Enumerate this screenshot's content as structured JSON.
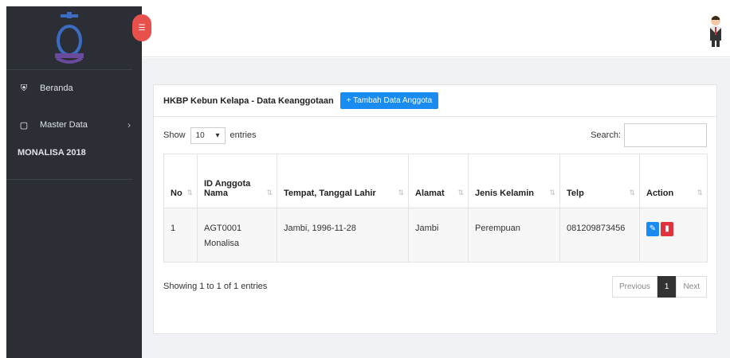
{
  "sidebar": {
    "items": [
      {
        "icon": "home-icon",
        "label": "Beranda",
        "has_chevron": false
      },
      {
        "icon": "clipboard-icon",
        "label": "Master Data",
        "has_chevron": true
      }
    ],
    "section_label": "MONALISA 2018"
  },
  "card": {
    "title": "HKBP Kebun Kelapa - Data Keanggotaan",
    "add_button": "+ Tambah Data Anggota"
  },
  "controls": {
    "show_label": "Show",
    "entries_value": "10",
    "entries_label": "entries",
    "search_label": "Search:"
  },
  "table": {
    "headers": [
      "No",
      "ID Anggota",
      "Nama",
      "Tempat, Tanggal Lahir",
      "Alamat",
      "Jenis Kelamin",
      "Telp",
      "Action"
    ],
    "rows": [
      {
        "no": "1",
        "id": "AGT0001",
        "nama": "Monalisa",
        "ttl": "Jambi, 1996-11-28",
        "alamat": "Jambi",
        "jk": "Perempuan",
        "telp": "081209873456"
      }
    ]
  },
  "footer": {
    "info": "Showing 1 to 1 of 1 entries",
    "prev": "Previous",
    "page": "1",
    "next": "Next"
  },
  "colors": {
    "sidebar": "#2b2f35",
    "accent": "#1a8cf0",
    "toggle": "#e8514b",
    "delete": "#e0323c"
  }
}
